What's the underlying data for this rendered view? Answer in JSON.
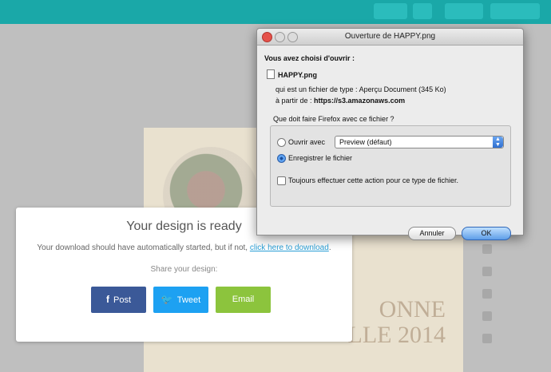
{
  "app": {
    "topbar_buttons": [
      {
        "label": ""
      },
      {
        "label": ""
      },
      {
        "label": ""
      },
      {
        "label": ""
      }
    ],
    "design": {
      "decorative_text_line1": "ONNE",
      "decorative_text_line2": "LLE 2014"
    }
  },
  "ready_modal": {
    "title": "Your design is ready",
    "text_before_link": "Your download should have automatically started, but if not, ",
    "link_text": "click here to download",
    "text_after_link": ".",
    "share_label": "Share your design:",
    "buttons": {
      "post": {
        "icon": "f",
        "label": "Post",
        "color": "#3b5998"
      },
      "tweet": {
        "icon": "🐦",
        "label": "Tweet",
        "color": "#1da1f2"
      },
      "email": {
        "label": "Email",
        "color": "#8cc43d"
      }
    }
  },
  "firefox_dialog": {
    "title": "Ouverture de HAPPY.png",
    "heading": "Vous avez choisi d'ouvrir :",
    "file_name": "HAPPY.png",
    "type_label": "qui est un fichier de type :",
    "type_value": "Aperçu Document (345 Ko)",
    "from_label": "à partir de :",
    "from_value": "https://s3.amazonaws.com",
    "question": "Que doit faire Firefox avec ce fichier ?",
    "open_with_label": "Ouvrir avec",
    "open_with_value": "Preview (défaut)",
    "save_label": "Enregistrer le fichier",
    "save_selected": true,
    "always_label": "Toujours effectuer cette action pour ce type de fichier.",
    "cancel_label": "Annuler",
    "ok_label": "OK"
  }
}
